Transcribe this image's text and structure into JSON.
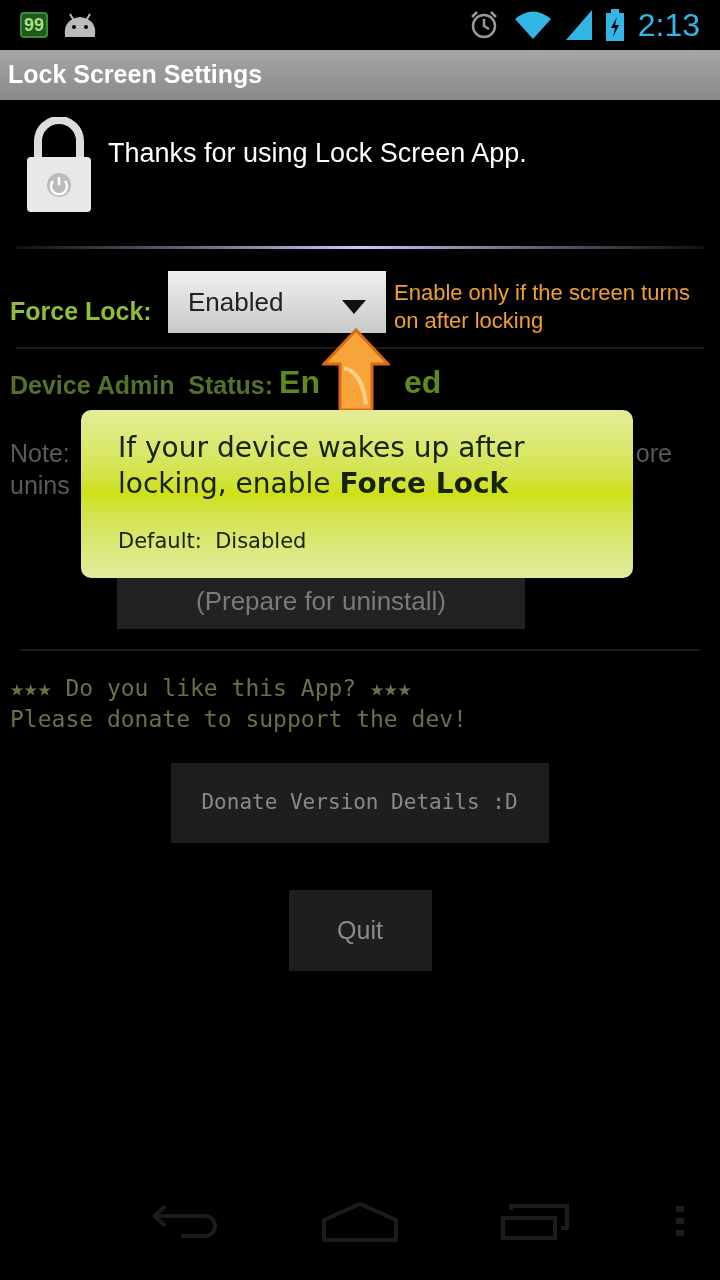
{
  "status_bar": {
    "notification_badge": "99",
    "time": "2:13"
  },
  "title_bar": {
    "title": "Lock Screen Settings"
  },
  "header": {
    "message": "Thanks for using Lock Screen App."
  },
  "force_lock": {
    "label": "Force Lock:",
    "dropdown": {
      "value": "Enabled"
    },
    "hint": "Enable only if the screen turns on after locking"
  },
  "device_admin": {
    "label": "Device Admin  Status:",
    "status_parts": [
      "En",
      "ed"
    ]
  },
  "note": {
    "left_lines": [
      "Note:",
      "unins"
    ],
    "right_fragment": "ore"
  },
  "uninstall_button": {
    "label": "(Prepare for uninstall)"
  },
  "donate": {
    "lines": [
      "★★★ Do you like this App? ★★★",
      "Please donate to support the dev!"
    ],
    "button": {
      "label": "Donate Version Details :D"
    }
  },
  "quit_button": {
    "label": "Quit"
  },
  "tooltip": {
    "message": "If your device wakes up after locking, enable **Force Lock**",
    "default_line": "Default:  Disabled"
  }
}
